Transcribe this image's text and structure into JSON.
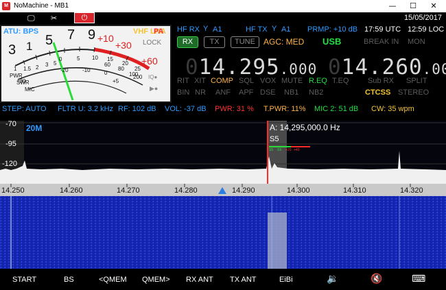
{
  "window": {
    "title": "NoMachine - MB1",
    "app_icon": "nomachine-icon",
    "minimize": "—",
    "maximize": "☐",
    "close": "✕"
  },
  "toolbar": {
    "date": "15/05/2017"
  },
  "meter": {
    "atu": "ATU: BPS",
    "vhf_lna": "VHF LNA",
    "pa": "PA",
    "lock": "LOCK",
    "s_scale": [
      "1",
      "3",
      "5",
      "7",
      "9"
    ],
    "plus_scale": [
      "+10",
      "+30",
      "+60"
    ],
    "power_scale": [
      "0",
      "5",
      "10",
      "15",
      "20",
      "25"
    ],
    "swr_scale": [
      "1",
      "1.5",
      "2",
      "3",
      "5"
    ],
    "db_scale": [
      "-30",
      "-20",
      "-10",
      "0",
      "+5"
    ],
    "side_labels": [
      "PWR",
      "SWR",
      "MIC"
    ],
    "alc_scale": [
      "20",
      "40",
      "60",
      "80",
      "100",
      "200"
    ]
  },
  "radio": {
    "hf_rx": "HF RX",
    "a1_rx": "A1",
    "hf_tx": "HF TX",
    "a1_tx": "A1",
    "prmp": "PRMP: +10 dB",
    "utc": "17:59 UTC",
    "loc": "12:59 LOC",
    "buttons": {
      "rx": "RX",
      "tx": "TX",
      "tune": "TUNE"
    },
    "agc": "AGC: MED",
    "mode": "USB",
    "break_in": "BREAK IN",
    "mon": "MON",
    "rx_freq_main": "14.295",
    "rx_freq_sub": ".000",
    "tx_freq_main": "14.260",
    "tx_freq_sub": ".000",
    "freq_prefix": "0",
    "row1": [
      "RIT",
      "XIT",
      "COMP",
      "SQL",
      "VOX",
      "MUTE",
      "R.EQ",
      "T.EQ",
      "Sub RX",
      "SPLIT"
    ],
    "row2": [
      "BIN",
      "NR",
      "ANF",
      "APF",
      "DSE",
      "NB1",
      "NB2",
      "CTCSS",
      "STEREO"
    ]
  },
  "status": {
    "step": "STEP: AUTO",
    "fltr": "FLTR U: 3.2 kHz",
    "rf": "RF: 102 dB",
    "vol": "VOL: -37 dB",
    "pwr": "PWR: 31 %",
    "tpwr": "T.PWR: 11%",
    "mic2": "MIC 2: 51 dB",
    "cw": "CW: 35 wpm"
  },
  "spectrum": {
    "band": "20M",
    "marker_freq": "A: 14,295,000.0 Hz",
    "s_reading": "S5",
    "db_labels": [
      "-70",
      "-95",
      "-120"
    ],
    "s_ticks": [
      "S5",
      "S9",
      "+20",
      "+40"
    ],
    "freq_labels": [
      "14.250",
      "14.260",
      "14.270",
      "14.280",
      "14.290",
      "14.300",
      "14.310",
      "14.320"
    ]
  },
  "bottom": {
    "start": "START",
    "bs": "BS",
    "qmem_l": "<QMEM",
    "qmem_r": "QMEM>",
    "rx_ant": "RX ANT",
    "tx_ant": "TX ANT",
    "eibi": "EiBi"
  },
  "colors": {
    "accent_blue": "#2e9bff",
    "rx_green": "#22dd44",
    "alert_red": "#ff3030",
    "power_red": "#d8262c"
  }
}
